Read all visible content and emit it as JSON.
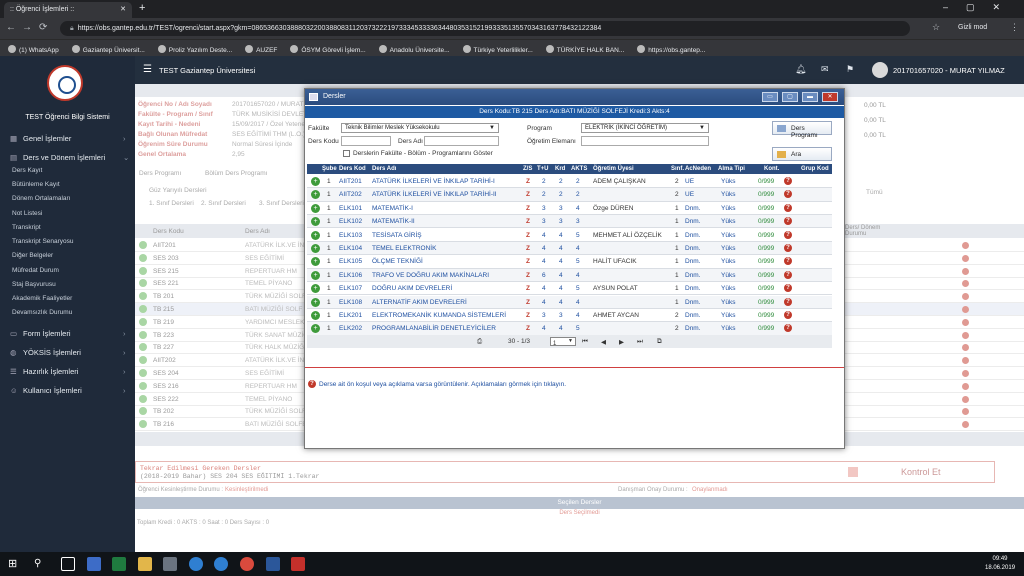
{
  "browser": {
    "tab_title": ":: Öğrenci İşlemleri ::",
    "url": "https://obs.gantep.edu.tr/TEST/ogrenci/start.aspx?gkm=086536630388803220038808311203732221973334533336344803531521993335135570343163778432122384",
    "incognito_label": "Gizli mod",
    "bookmarks": [
      "(1) WhatsApp",
      "Gaziantep Üniversit...",
      "Proliz Yazılım Deste...",
      "AUZEF",
      "ÖSYM Görevli İşlem...",
      "Anadolu Üniversite...",
      "Türkiye Yeterlilikler...",
      "TÜRKİYE HALK BAN...",
      "https://obs.gantep..."
    ]
  },
  "sidebar": {
    "system_title": "TEST Öğrenci Bilgi Sistemi",
    "main_items": [
      "Genel İşlemler",
      "Ders ve Dönem İşlemleri",
      "Form İşlemleri",
      "YÖKSİS İşlemleri",
      "Hazırlık İşlemleri",
      "Kullanıcı İşlemleri"
    ],
    "sub_items": [
      "Ders Kayıt",
      "Bütünleme Kayıt",
      "Dönem Ortalamaları",
      "Not Listesi",
      "Transkript",
      "Transkript Senaryosu",
      "Diğer Belgeler",
      "Müfredat Durum",
      "Staj Başvurusu",
      "Akademik Faaliyetler",
      "Devamsızlık Durumu"
    ]
  },
  "header": {
    "university": "TEST Gaziantep Üniversitesi",
    "user": "201701657020 - MURAT YILMAZ"
  },
  "background": {
    "labels": [
      "Öğrenci No / Adı Soyadı",
      "Fakülte - Program / Sınıf",
      "Kayıt Tarihi - Nedeni",
      "Bağlı Olunan Müfredat",
      "Öğrenim Süre Durumu",
      "Genel Ortalama"
    ],
    "values": [
      "201701657020 / MURAT",
      "TÜRK MUSİKİSİ DEVLET",
      "15/09/2017 / Özel Yetenek",
      "SES EĞİTİMİ THM (L.O.)",
      "Normal Süresi İçinde",
      "2,95"
    ],
    "right_values": [
      "0,00 TL",
      "0,00 TL",
      "0,00 TL"
    ],
    "tabs": [
      "Ders Programı",
      "Bölüm Ders Programı"
    ],
    "radio_label": "Güz Yarıyılı Dersleri",
    "sinif_tabs": [
      "1. Sınıf Dersleri",
      "2. Sınıf Dersleri",
      "3. Sınıf Dersleri"
    ],
    "radio_all": "Tümü",
    "col_code": "Ders Kodu",
    "col_name": "Ders Adı",
    "col_right": "Ders/ Dönem Durumu",
    "rows": [
      [
        "AIIT201",
        "ATATÜRK İLK.VE İNK"
      ],
      [
        "SES 203",
        "SES EĞİTİMİ"
      ],
      [
        "SES 215",
        "REPERTUAR HM"
      ],
      [
        "SES 221",
        "TEMEL PİYANO"
      ],
      [
        "TB 201",
        "TÜRK MÜZİĞİ SOLFEJ"
      ],
      [
        "TB 215",
        "BATI MÜZİĞİ SOLF"
      ],
      [
        "TB 219",
        "YARDIMCI MESLEK Ç"
      ],
      [
        "TB 223",
        "TÜRK SANAT MÜZİĞİ"
      ],
      [
        "TB 227",
        "TÜRK HALK MÜZİĞİ"
      ],
      [
        "AIIT202",
        "ATATÜRK İLK.VE İNK"
      ],
      [
        "SES 204",
        "SES EĞİTİMİ"
      ],
      [
        "SES 216",
        "REPERTUAR HM"
      ],
      [
        "SES 222",
        "TEMEL PİYANO"
      ],
      [
        "TB 202",
        "TÜRK MÜZİĞİ SOLFEJ"
      ],
      [
        "TB 216",
        "BATI MÜZİĞİ SOLFEJ"
      ]
    ],
    "tekrar_title": "Tekrar Edilmesi Gereken Dersler",
    "tekrar_line": "(2018-2019 Bahar) SES 204 SES EĞİTİMİ 1.Tekrar",
    "kontrol_label": "Kontrol Et",
    "onay_label": "Öğrenci Kesinleştirme Durumu :",
    "onay_value": "Kesinleştirilmedi",
    "danisman_label": "Danışman Onay Durumu :",
    "danisman_value": "Onaylanmadı",
    "secilen_title": "Seçilen Dersler",
    "secilen_sub": "Ders Seçilmedi",
    "totals": "Toplam Kredi : 0   AKTS : 0   Saat : 0   Ders Sayısı : 0"
  },
  "modal": {
    "title": "Dersler",
    "lesson_info": "Ders Kodu:TB 215 Ders Adı:BATI MÜZİĞİ SOLFEJİ Kredi:3 Akts:4",
    "fakulte_label": "Fakülte",
    "fakulte_value": "Teknik Bilimler Meslek Yüksekokulu",
    "program_label": "Program",
    "program_value": "ELEKTRİK (İKİNCİ ÖĞRETİM)",
    "ders_kodu_label": "Ders Kodu",
    "ders_adi_label": "Ders Adı",
    "ogretim_label": "Öğretim Elemanı",
    "checkbox_label": "Derslerin Fakülte - Bölüm - Programlarını Göster",
    "btn_program": "Ders Programı",
    "btn_ara": "Ara",
    "columns": [
      "Şube",
      "Ders Kod",
      "Ders Adı",
      "Z/S",
      "T+U",
      "Krd",
      "AKTS",
      "Öğretim Üyesi",
      "Sınf.",
      "AcNeden",
      "Alma Tipi",
      "Kont.",
      "Grup Kod"
    ],
    "rows": [
      {
        "sube": "1",
        "kod": "AIIT201",
        "ad": "ATATÜRK İLKELERİ VE İNKILAP TARİHİ-I",
        "zs": "Z",
        "tu": "2",
        "krd": "2",
        "akts": "2",
        "hoca": "ADEM ÇALIŞKAN",
        "sinif": "2",
        "neden": "UE",
        "tip": "Yüks",
        "kont": "0/999"
      },
      {
        "sube": "1",
        "kod": "AIIT202",
        "ad": "ATATÜRK İLKELERİ VE İNKILAP TARİHİ-II",
        "zs": "Z",
        "tu": "2",
        "krd": "2",
        "akts": "2",
        "hoca": "",
        "sinif": "2",
        "neden": "UE",
        "tip": "Yüks",
        "kont": "0/999"
      },
      {
        "sube": "1",
        "kod": "ELK101",
        "ad": "MATEMATİK-I",
        "zs": "Z",
        "tu": "3",
        "krd": "3",
        "akts": "4",
        "hoca": "Özge DÜREN",
        "sinif": "1",
        "neden": "Dnm.",
        "tip": "Yüks",
        "kont": "0/999"
      },
      {
        "sube": "1",
        "kod": "ELK102",
        "ad": "MATEMATİK-II",
        "zs": "Z",
        "tu": "3",
        "krd": "3",
        "akts": "3",
        "hoca": "",
        "sinif": "1",
        "neden": "Dnm.",
        "tip": "Yüks",
        "kont": "0/999"
      },
      {
        "sube": "1",
        "kod": "ELK103",
        "ad": "TESİSATA GİRİŞ",
        "zs": "Z",
        "tu": "4",
        "krd": "4",
        "akts": "5",
        "hoca": "MEHMET ALİ ÖZÇELİK",
        "sinif": "1",
        "neden": "Dnm.",
        "tip": "Yüks",
        "kont": "0/999"
      },
      {
        "sube": "1",
        "kod": "ELK104",
        "ad": "TEMEL ELEKTRONİK",
        "zs": "Z",
        "tu": "4",
        "krd": "4",
        "akts": "4",
        "hoca": "",
        "sinif": "1",
        "neden": "Dnm.",
        "tip": "Yüks",
        "kont": "0/999"
      },
      {
        "sube": "1",
        "kod": "ELK105",
        "ad": "ÖLÇME TEKNİĞİ",
        "zs": "Z",
        "tu": "4",
        "krd": "4",
        "akts": "5",
        "hoca": "HALİT UFACIK",
        "sinif": "1",
        "neden": "Dnm.",
        "tip": "Yüks",
        "kont": "0/999"
      },
      {
        "sube": "1",
        "kod": "ELK106",
        "ad": "TRAFO VE DOĞRU AKIM MAKİNALARI",
        "zs": "Z",
        "tu": "6",
        "krd": "4",
        "akts": "4",
        "hoca": "",
        "sinif": "1",
        "neden": "Dnm.",
        "tip": "Yüks",
        "kont": "0/999"
      },
      {
        "sube": "1",
        "kod": "ELK107",
        "ad": "DOĞRU AKIM DEVRELERİ",
        "zs": "Z",
        "tu": "4",
        "krd": "4",
        "akts": "5",
        "hoca": "AYSUN POLAT",
        "sinif": "1",
        "neden": "Dnm.",
        "tip": "Yüks",
        "kont": "0/999"
      },
      {
        "sube": "1",
        "kod": "ELK108",
        "ad": "ALTERNATİF AKIM DEVRELERİ",
        "zs": "Z",
        "tu": "4",
        "krd": "4",
        "akts": "4",
        "hoca": "",
        "sinif": "1",
        "neden": "Dnm.",
        "tip": "Yüks",
        "kont": "0/999"
      },
      {
        "sube": "1",
        "kod": "ELK201",
        "ad": "ELEKTROMEKANİK KUMANDA SİSTEMLERİ",
        "zs": "Z",
        "tu": "3",
        "krd": "3",
        "akts": "4",
        "hoca": "AHMET AYCAN",
        "sinif": "2",
        "neden": "Dnm.",
        "tip": "Yüks",
        "kont": "0/999"
      },
      {
        "sube": "1",
        "kod": "ELK202",
        "ad": "PROGRAMLANABİLİR DENETLEYİCİLER",
        "zs": "Z",
        "tu": "4",
        "krd": "4",
        "akts": "5",
        "hoca": "",
        "sinif": "2",
        "neden": "Dnm.",
        "tip": "Yüks",
        "kont": "0/999"
      }
    ],
    "pager_text": "30 - 1/3",
    "page_value": "1",
    "note": "Derse ait ön koşul veya açıklama varsa görüntülenir. Açıklamaları görmek için tıklayın."
  },
  "taskbar": {
    "time": "09:49",
    "date": "18.06.2019"
  }
}
